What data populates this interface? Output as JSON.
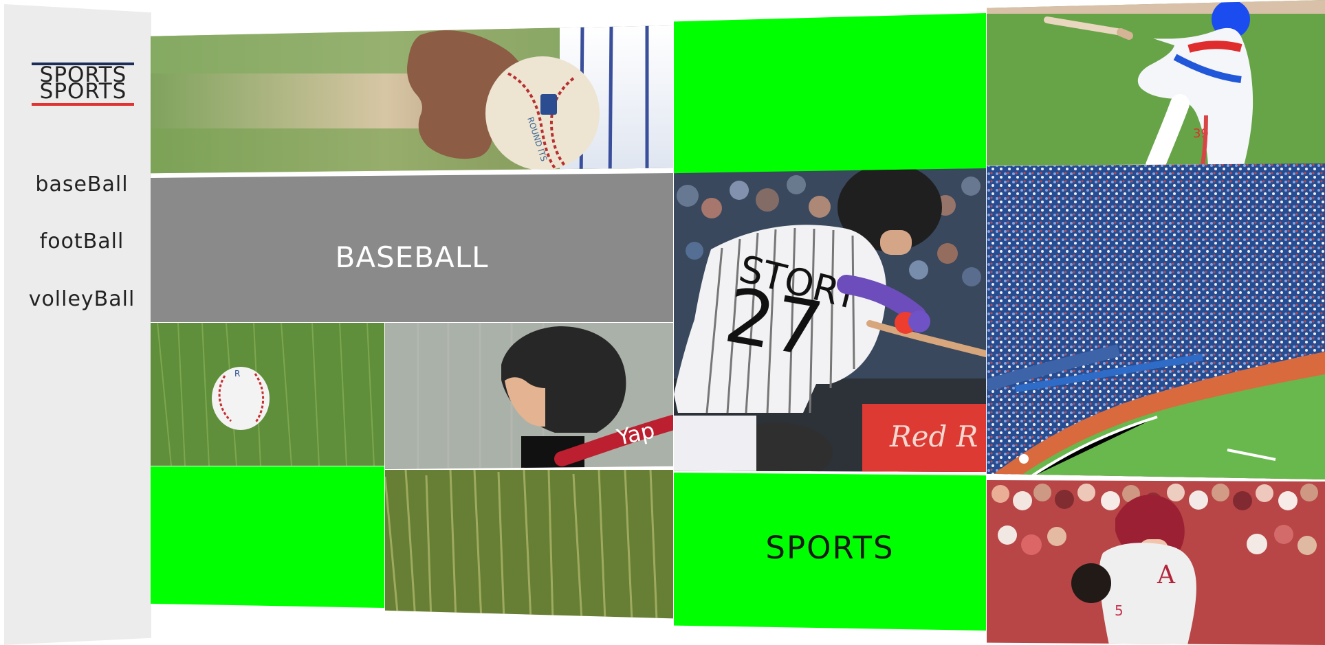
{
  "sidebar": {
    "logo": {
      "words": [
        "SPORTS",
        "SPORTS"
      ]
    },
    "nav": [
      {
        "label": "baseBall"
      },
      {
        "label": "footBall"
      },
      {
        "label": "volleyBall"
      }
    ]
  },
  "main": {
    "tiles": {
      "baseball_label": "BASEBALL",
      "sports_label": "SPORTS",
      "player_number_1": "27",
      "player_name_1": "STORY",
      "player_number_2": "39",
      "banner_text": "Red R"
    }
  }
}
